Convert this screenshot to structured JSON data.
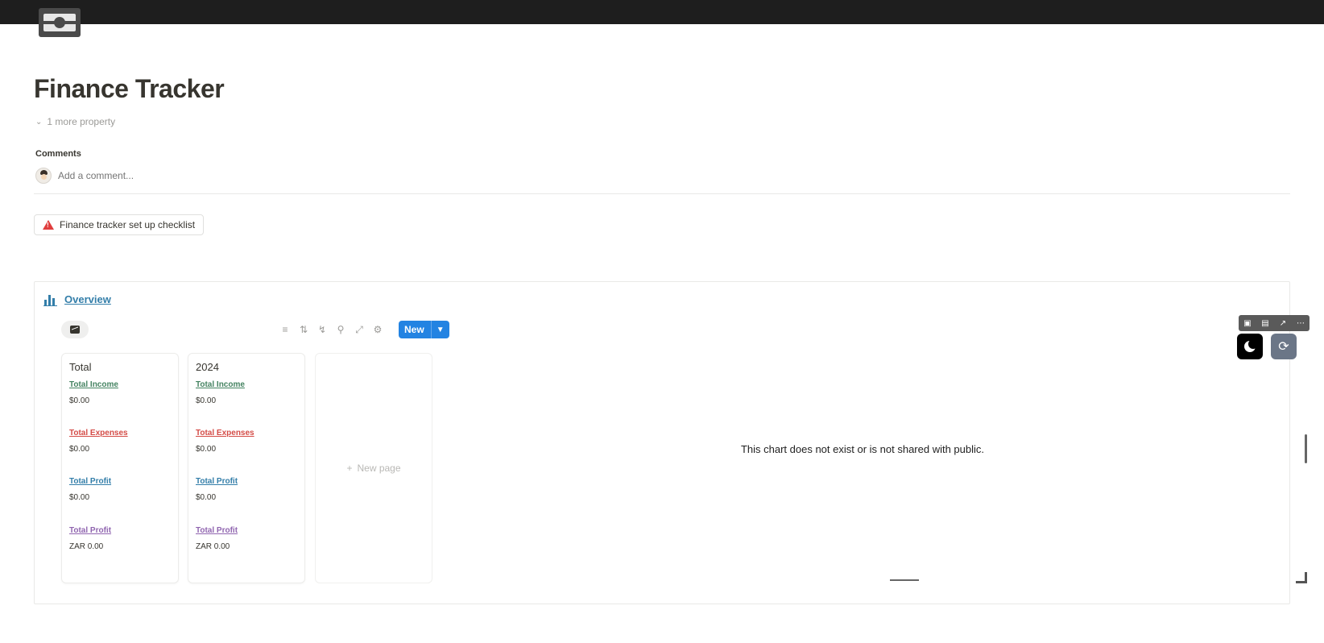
{
  "page": {
    "title": "Finance Tracker",
    "more_property": "1 more property",
    "page_icon": "money-bill-icon"
  },
  "comments": {
    "label": "Comments",
    "placeholder": "Add a comment..."
  },
  "checklist": {
    "label": "Finance tracker set up checklist",
    "icon": "warning-icon",
    "icon_color": "#e03e3e"
  },
  "overview": {
    "title": "Overview",
    "accent": "#337ea9",
    "toolbar": {
      "new_label": "New",
      "new_color": "#2383e2"
    },
    "cards": [
      {
        "title": "Total",
        "fields": [
          {
            "label": "Total Income",
            "value": "$0.00",
            "color": "#448361"
          },
          {
            "label": "Total Expenses",
            "value": "$0.00",
            "color": "#d44c47"
          },
          {
            "label": "Total Profit",
            "value": "$0.00",
            "color": "#337ea9"
          },
          {
            "label": "Total Profit",
            "value": "ZAR 0.00",
            "color": "#9065b0"
          }
        ]
      },
      {
        "title": "2024",
        "fields": [
          {
            "label": "Total Income",
            "value": "$0.00",
            "color": "#448361"
          },
          {
            "label": "Total Expenses",
            "value": "$0.00",
            "color": "#d44c47"
          },
          {
            "label": "Total Profit",
            "value": "$0.00",
            "color": "#337ea9"
          },
          {
            "label": "Total Profit",
            "value": "ZAR 0.00",
            "color": "#9065b0"
          }
        ]
      }
    ],
    "new_page_label": "New page",
    "chart_message": "This chart does not exist or is not shared with public."
  }
}
